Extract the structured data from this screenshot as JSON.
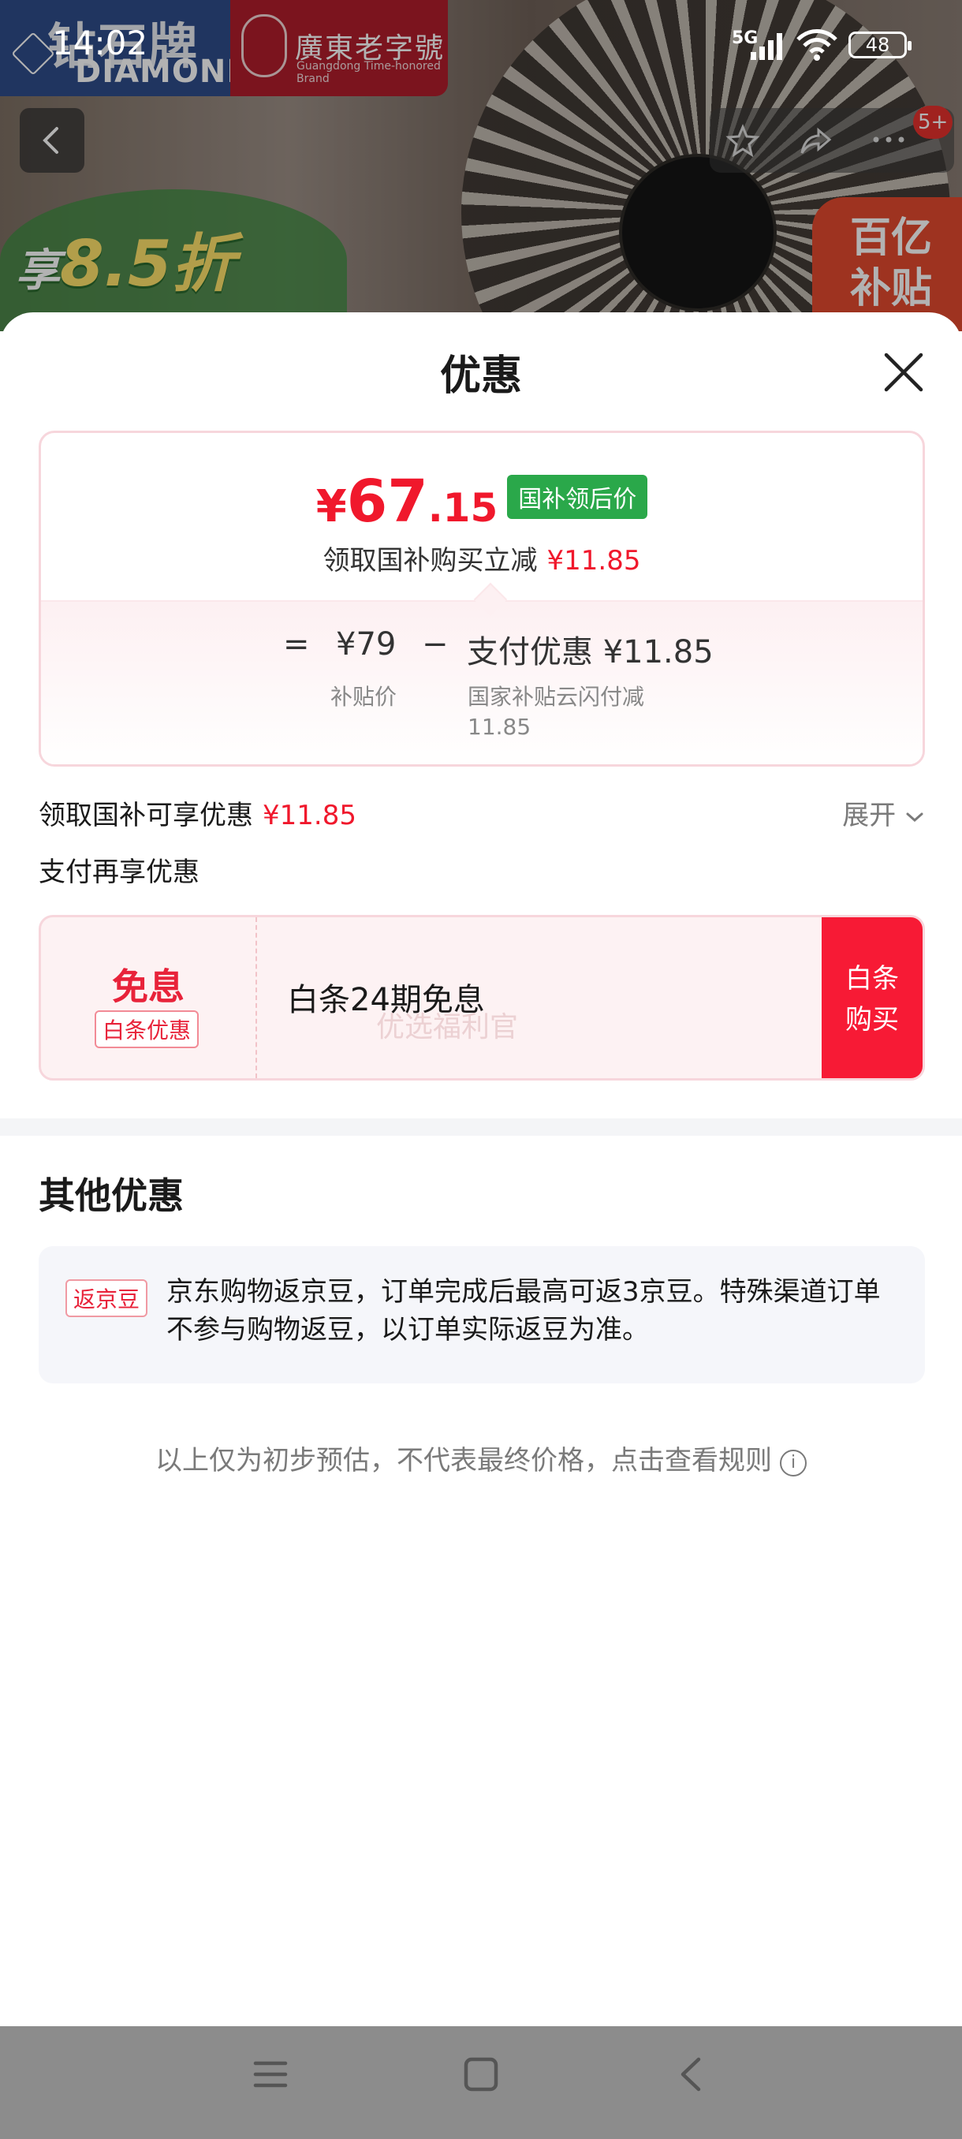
{
  "status_bar": {
    "time": "14:02",
    "network": "5G",
    "battery": "48"
  },
  "background": {
    "brand_en": "DIAMOND",
    "brand_cn": "钻石牌",
    "brand2_cn": "廣東老字號",
    "brand2_en": "Guangdong Time-honored Brand",
    "promo_prefix": "享",
    "promo_discount": "8.5折",
    "subsidy_badge_l1": "百亿",
    "subsidy_badge_l2": "补贴",
    "notification_count": "5+"
  },
  "sheet": {
    "title": "优惠",
    "price": {
      "currency": "¥",
      "integer": "67",
      "decimal": ".15",
      "tag": "国补领后价"
    },
    "price_sub": {
      "text": "领取国补购买立减",
      "amount": "¥11.85"
    },
    "calc": {
      "equals": "=",
      "base": "¥79",
      "base_caption": "补贴价",
      "minus": "−",
      "discount": "支付优惠 ¥11.85",
      "discount_caption_1": "国家补贴云闪付减",
      "discount_caption_2": "11.85"
    },
    "subsidy_row": {
      "label": "领取国补可享优惠",
      "amount": "¥11.85",
      "expand": "展开"
    },
    "pay_row_label": "支付再享优惠",
    "baitiao": {
      "title": "免息",
      "chip": "白条优惠",
      "description": "白条24期免息",
      "watermark": "优选福利官",
      "buy_line1": "白条",
      "buy_line2": "购买"
    },
    "other": {
      "title": "其他优惠",
      "tag": "返京豆",
      "text": "京东购物返京豆，订单完成后最高可返3京豆。特殊渠道订单不参与购物返豆，以订单实际返豆为准。"
    },
    "footnote": "以上仅为初步预估，不代表最终价格，点击查看规则",
    "info_icon_glyph": "i"
  },
  "colors": {
    "accent_red": "#f0182c",
    "tag_green": "#2aa84a",
    "buy_red": "#f71a35"
  }
}
